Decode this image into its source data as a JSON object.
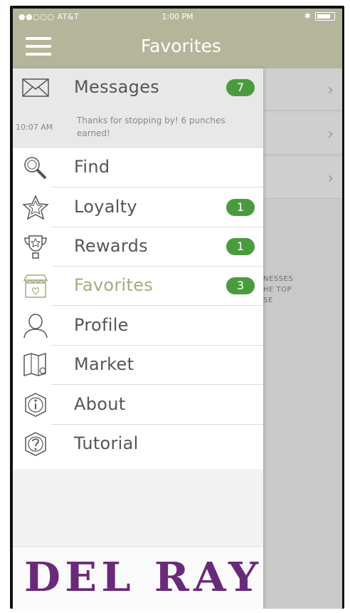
{
  "status_bar": {
    "carrier": "●●○○○ AT&T",
    "time": "1:00 PM"
  },
  "nav": {
    "title": "Favorites"
  },
  "messages": {
    "label": "Messages",
    "badge": "7",
    "time": "10:07 AM",
    "preview": "Thanks for stopping by! 6 punches earned!"
  },
  "menu": [
    {
      "label": "Find",
      "icon": "magnifier-icon",
      "badge": ""
    },
    {
      "label": "Loyalty",
      "icon": "star-icon",
      "badge": "1"
    },
    {
      "label": "Rewards",
      "icon": "trophy-icon",
      "badge": "1"
    },
    {
      "label": "Favorites",
      "icon": "storefront-icon",
      "badge": "3"
    },
    {
      "label": "Profile",
      "icon": "person-icon",
      "badge": ""
    },
    {
      "label": "Market",
      "icon": "map-icon",
      "badge": ""
    },
    {
      "label": "About",
      "icon": "info-icon",
      "badge": ""
    },
    {
      "label": "Tutorial",
      "icon": "question-icon",
      "badge": ""
    }
  ],
  "background_text": [
    "NESSES",
    "HE TOP",
    "SE"
  ],
  "logo": {
    "text": "DEL RAY",
    "color": "#6a2a7a"
  },
  "colors": {
    "nav_bg": "#b4b59a",
    "badge_green": "#4a9b3e",
    "active_label": "#a8a97f"
  }
}
